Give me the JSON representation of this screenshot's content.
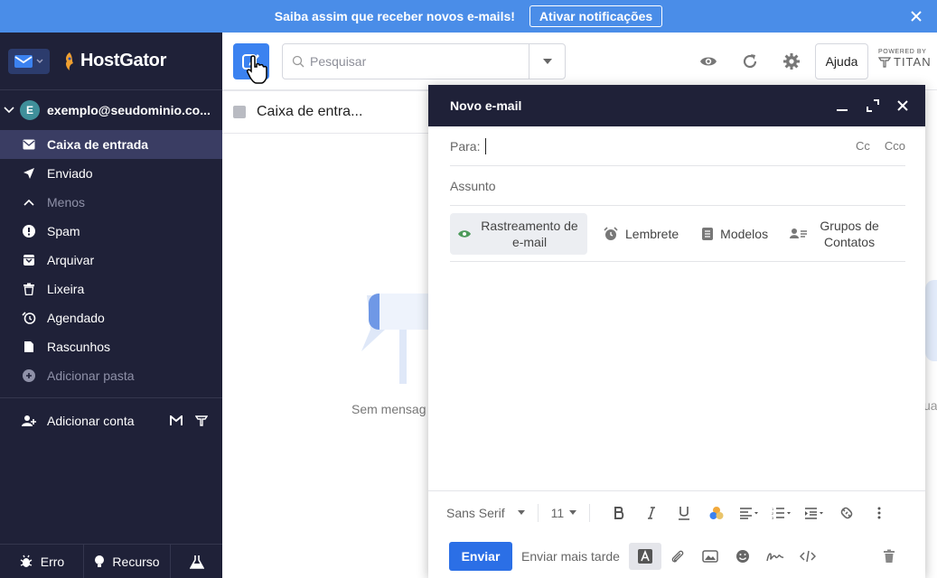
{
  "banner": {
    "text": "Saiba assim que receber novos e-mails!",
    "button": "Ativar notificações"
  },
  "brand": {
    "name": "HostGator"
  },
  "account": {
    "initial": "E",
    "email": "exemplo@seudominio.co..."
  },
  "nav": [
    {
      "label": "Caixa de entrada",
      "icon": "inbox-icon"
    },
    {
      "label": "Enviado",
      "icon": "send-icon"
    },
    {
      "label": "Menos",
      "icon": "chevron-up-icon"
    },
    {
      "label": "Spam",
      "icon": "alert-icon"
    },
    {
      "label": "Arquivar",
      "icon": "archive-icon"
    },
    {
      "label": "Lixeira",
      "icon": "trash-icon"
    },
    {
      "label": "Agendado",
      "icon": "clock-icon"
    },
    {
      "label": "Rascunhos",
      "icon": "draft-icon"
    },
    {
      "label": "Adicionar pasta",
      "icon": "plus-icon"
    }
  ],
  "add_account": "Adicionar conta",
  "footer": {
    "error": "Erro",
    "feature": "Recurso"
  },
  "search": {
    "placeholder": "Pesquisar"
  },
  "help": "Ajuda",
  "powered": {
    "small": "POWERED BY",
    "brand": "TITAN"
  },
  "list": {
    "title": "Caixa de entra..."
  },
  "empty": {
    "text": "Sem mensag",
    "text_right": "ua"
  },
  "compose": {
    "title": "Novo e-mail",
    "to_label": "Para:",
    "cc": "Cc",
    "bcc": "Cco",
    "subject": "Assunto",
    "tracking_line1": "Rastreamento de",
    "tracking_line2": "e-mail",
    "reminder": "Lembrete",
    "templates": "Modelos",
    "groups_line1": "Grupos de",
    "groups_line2": "Contatos",
    "font": "Sans Serif",
    "size": "11",
    "send": "Enviar",
    "send_later": "Enviar mais tarde"
  },
  "colors": {
    "accent": "#3b82f0",
    "sidebar": "#1f2138",
    "banner": "#4a8de8"
  }
}
